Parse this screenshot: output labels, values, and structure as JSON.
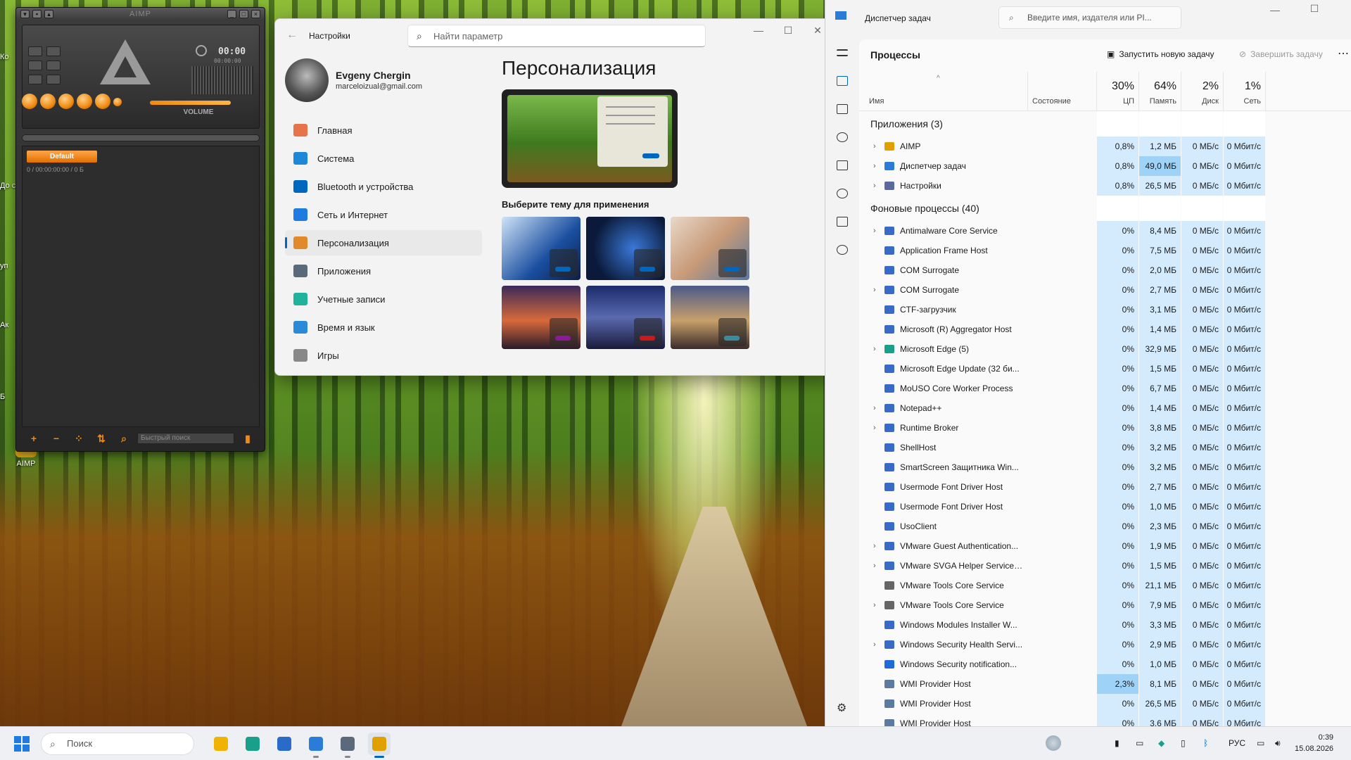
{
  "desktop": {
    "icons": [
      {
        "label": "AIMP"
      }
    ],
    "edge_labels": [
      "Ко",
      "До св",
      "уп",
      "Ак",
      "Б"
    ]
  },
  "aimp": {
    "title": "AIMP",
    "time": "00:00",
    "time_sub": "00:00:00",
    "volume_label": "VOLUME",
    "playlist_tab": "Default",
    "playlist_info": "0 / 00:00:00:00 / 0 Б",
    "search_placeholder": "Быстрый поиск"
  },
  "settings": {
    "app_title": "Настройки",
    "search_placeholder": "Найти параметр",
    "user_name": "Evgeny Chergin",
    "user_email": "marceloizual@gmail.com",
    "nav": [
      {
        "label": "Главная",
        "icon": "home-icon",
        "color": "#e8734a"
      },
      {
        "label": "Система",
        "icon": "monitor-icon",
        "color": "#1e88d8"
      },
      {
        "label": "Bluetooth и устройства",
        "icon": "bluetooth-icon",
        "color": "#0067c0"
      },
      {
        "label": "Сеть и Интернет",
        "icon": "wifi-icon",
        "color": "#1e7be0"
      },
      {
        "label": "Персонализация",
        "icon": "brush-icon",
        "color": "#e08a2a",
        "active": true
      },
      {
        "label": "Приложения",
        "icon": "apps-icon",
        "color": "#5a6a7a"
      },
      {
        "label": "Учетные записи",
        "icon": "person-icon",
        "color": "#1eb39a"
      },
      {
        "label": "Время и язык",
        "icon": "clock-globe-icon",
        "color": "#2a8ad8"
      },
      {
        "label": "Игры",
        "icon": "gamepad-icon",
        "color": "#888888"
      }
    ],
    "page_title": "Персонализация",
    "themes_label": "Выберите тему для применения",
    "themes": [
      {
        "name": "windows-light",
        "bg": "linear-gradient(135deg,#cfe3f7,#1a4fa0 60%,#0b1f4a)",
        "accent": "#0067c0"
      },
      {
        "name": "windows-dark",
        "bg": "radial-gradient(circle at 60% 50%,#3a78d8,#0b1a3a 70%)",
        "accent": "#0067c0"
      },
      {
        "name": "glow",
        "bg": "linear-gradient(135deg,#e8d8c8,#c89a78 50%,#5a7aa0)",
        "accent": "#0067c0"
      },
      {
        "name": "sunset",
        "bg": "linear-gradient(180deg,#3a2a5a,#d86a3a 55%,#2a1a2a)",
        "accent": "#8a1a9a"
      },
      {
        "name": "car",
        "bg": "linear-gradient(180deg,#1a2a6a,#5a6ab0 50%,#1a1a3a)",
        "accent": "#c81a1a"
      },
      {
        "name": "evening",
        "bg": "linear-gradient(180deg,#4a5a8a,#c8a06a 55%,#3a2a2a)",
        "accent": "#3a8aa0"
      }
    ]
  },
  "taskmgr": {
    "title": "Диспетчер задач",
    "search_placeholder": "Введите имя, издателя или PI...",
    "section": "Процессы",
    "run_task": "Запустить новую задачу",
    "end_task": "Завершить задачу",
    "columns": {
      "name": "Имя",
      "status": "Состояние",
      "cpu_pct": "30%",
      "cpu": "ЦП",
      "mem_pct": "64%",
      "mem": "Память",
      "disk_pct": "2%",
      "disk": "Диск",
      "net_pct": "1%",
      "net": "Сеть"
    },
    "groups": [
      {
        "label": "Приложения (3)",
        "rows": [
          {
            "name": "AIMP",
            "cpu": "0,8%",
            "mem": "1,2 МБ",
            "disk": "0 МБ/с",
            "net": "0 Мбит/с",
            "exp": true,
            "icon_color": "#e0a000"
          },
          {
            "name": "Диспетчер задач",
            "cpu": "0,8%",
            "mem": "49,0 МБ",
            "disk": "0 МБ/с",
            "net": "0 Мбит/с",
            "exp": true,
            "icon_color": "#2b7bd8",
            "mem_hi": true
          },
          {
            "name": "Настройки",
            "cpu": "0,8%",
            "mem": "26,5 МБ",
            "disk": "0 МБ/с",
            "net": "0 Мбит/с",
            "exp": true,
            "icon_color": "#5a6a9a"
          }
        ]
      },
      {
        "label": "Фоновые процессы (40)",
        "rows": [
          {
            "name": "Antimalware Core Service",
            "cpu": "0%",
            "mem": "8,4 МБ",
            "disk": "0 МБ/с",
            "net": "0 Мбит/с",
            "exp": true,
            "icon_color": "#3a6ac8"
          },
          {
            "name": "Application Frame Host",
            "cpu": "0%",
            "mem": "7,5 МБ",
            "disk": "0 МБ/с",
            "net": "0 Мбит/с",
            "exp": false,
            "icon_color": "#3a6ac8"
          },
          {
            "name": "COM Surrogate",
            "cpu": "0%",
            "mem": "2,0 МБ",
            "disk": "0 МБ/с",
            "net": "0 Мбит/с",
            "exp": false,
            "icon_color": "#3a6ac8"
          },
          {
            "name": "COM Surrogate",
            "cpu": "0%",
            "mem": "2,7 МБ",
            "disk": "0 МБ/с",
            "net": "0 Мбит/с",
            "exp": true,
            "icon_color": "#3a6ac8"
          },
          {
            "name": "CTF-загрузчик",
            "cpu": "0%",
            "mem": "3,1 МБ",
            "disk": "0 МБ/с",
            "net": "0 Мбит/с",
            "exp": false,
            "icon_color": "#3a6ac8"
          },
          {
            "name": "Microsoft (R) Aggregator Host",
            "cpu": "0%",
            "mem": "1,4 МБ",
            "disk": "0 МБ/с",
            "net": "0 Мбит/с",
            "exp": false,
            "icon_color": "#3a6ac8"
          },
          {
            "name": "Microsoft Edge (5)",
            "cpu": "0%",
            "mem": "32,9 МБ",
            "disk": "0 МБ/с",
            "net": "0 Мбит/с",
            "exp": true,
            "icon_color": "#1aa08a"
          },
          {
            "name": "Microsoft Edge Update (32 би...",
            "cpu": "0%",
            "mem": "1,5 МБ",
            "disk": "0 МБ/с",
            "net": "0 Мбит/с",
            "exp": false,
            "icon_color": "#3a6ac8"
          },
          {
            "name": "MoUSO Core Worker Process",
            "cpu": "0%",
            "mem": "6,7 МБ",
            "disk": "0 МБ/с",
            "net": "0 Мбит/с",
            "exp": false,
            "icon_color": "#3a6ac8"
          },
          {
            "name": "Notepad++",
            "cpu": "0%",
            "mem": "1,4 МБ",
            "disk": "0 МБ/с",
            "net": "0 Мбит/с",
            "exp": true,
            "icon_color": "#3a6ac8"
          },
          {
            "name": "Runtime Broker",
            "cpu": "0%",
            "mem": "3,8 МБ",
            "disk": "0 МБ/с",
            "net": "0 Мбит/с",
            "exp": true,
            "icon_color": "#3a6ac8"
          },
          {
            "name": "ShellHost",
            "cpu": "0%",
            "mem": "3,2 МБ",
            "disk": "0 МБ/с",
            "net": "0 Мбит/с",
            "exp": false,
            "icon_color": "#3a6ac8"
          },
          {
            "name": "SmartScreen Защитника Win...",
            "cpu": "0%",
            "mem": "3,2 МБ",
            "disk": "0 МБ/с",
            "net": "0 Мбит/с",
            "exp": false,
            "icon_color": "#3a6ac8"
          },
          {
            "name": "Usermode Font Driver Host",
            "cpu": "0%",
            "mem": "2,7 МБ",
            "disk": "0 МБ/с",
            "net": "0 Мбит/с",
            "exp": false,
            "icon_color": "#3a6ac8"
          },
          {
            "name": "Usermode Font Driver Host",
            "cpu": "0%",
            "mem": "1,0 МБ",
            "disk": "0 МБ/с",
            "net": "0 Мбит/с",
            "exp": false,
            "icon_color": "#3a6ac8"
          },
          {
            "name": "UsoClient",
            "cpu": "0%",
            "mem": "2,3 МБ",
            "disk": "0 МБ/с",
            "net": "0 Мбит/с",
            "exp": false,
            "icon_color": "#3a6ac8"
          },
          {
            "name": "VMware Guest Authentication...",
            "cpu": "0%",
            "mem": "1,9 МБ",
            "disk": "0 МБ/с",
            "net": "0 Мбит/с",
            "exp": true,
            "icon_color": "#3a6ac8"
          },
          {
            "name": "VMware SVGA Helper Service (...",
            "cpu": "0%",
            "mem": "1,5 МБ",
            "disk": "0 МБ/с",
            "net": "0 Мбит/с",
            "exp": true,
            "icon_color": "#3a6ac8"
          },
          {
            "name": "VMware Tools Core Service",
            "cpu": "0%",
            "mem": "21,1 МБ",
            "disk": "0 МБ/с",
            "net": "0 Мбит/с",
            "exp": false,
            "icon_color": "#666666"
          },
          {
            "name": "VMware Tools Core Service",
            "cpu": "0%",
            "mem": "7,9 МБ",
            "disk": "0 МБ/с",
            "net": "0 Мбит/с",
            "exp": true,
            "icon_color": "#666666"
          },
          {
            "name": "Windows Modules Installer W...",
            "cpu": "0%",
            "mem": "3,3 МБ",
            "disk": "0 МБ/с",
            "net": "0 Мбит/с",
            "exp": false,
            "icon_color": "#3a6ac8"
          },
          {
            "name": "Windows Security Health Servi...",
            "cpu": "0%",
            "mem": "2,9 МБ",
            "disk": "0 МБ/с",
            "net": "0 Мбит/с",
            "exp": true,
            "icon_color": "#3a6ac8"
          },
          {
            "name": "Windows Security notification...",
            "cpu": "0%",
            "mem": "1,0 МБ",
            "disk": "0 МБ/с",
            "net": "0 Мбит/с",
            "exp": false,
            "icon_color": "#1e6ad8"
          },
          {
            "name": "WMI Provider Host",
            "cpu": "2,3%",
            "mem": "8,1 МБ",
            "disk": "0 МБ/с",
            "net": "0 Мбит/с",
            "exp": false,
            "icon_color": "#5a7aa0",
            "cpu_hi": true
          },
          {
            "name": "WMI Provider Host",
            "cpu": "0%",
            "mem": "26,5 МБ",
            "disk": "0 МБ/с",
            "net": "0 Мбит/с",
            "exp": false,
            "icon_color": "#5a7aa0"
          },
          {
            "name": "WMI Provider Host",
            "cpu": "0%",
            "mem": "3,6 МБ",
            "disk": "0 МБ/с",
            "net": "0 Мбит/с",
            "exp": false,
            "icon_color": "#5a7aa0"
          }
        ]
      }
    ]
  },
  "taskbar": {
    "search_placeholder": "Поиск",
    "apps": [
      {
        "name": "file-explorer-icon",
        "color": "#f0b400",
        "state": ""
      },
      {
        "name": "edge-icon",
        "color": "#1aa08a",
        "state": ""
      },
      {
        "name": "store-icon",
        "color": "#2a6ac8",
        "state": ""
      },
      {
        "name": "task-manager-icon",
        "color": "#2b7bd8",
        "state": "run"
      },
      {
        "name": "settings-icon",
        "color": "#5a6a7a",
        "state": "run"
      },
      {
        "name": "aimp-icon",
        "color": "#e0a000",
        "state": "act"
      }
    ],
    "lang": "РУС",
    "time": "0:39",
    "date": "15.08.2026"
  },
  "colors": {
    "accent": "#0067c0",
    "cpu_bg": "#d3ebfc",
    "cpu_hi_bg": "#9fd2f7"
  }
}
